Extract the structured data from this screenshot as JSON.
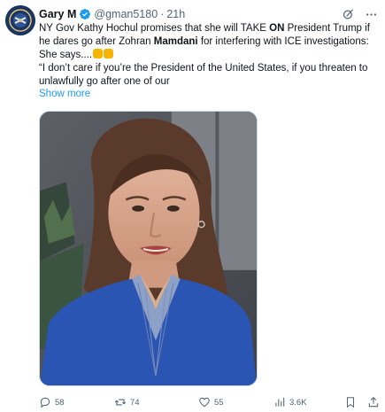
{
  "author": {
    "name": "Gary M",
    "handle": "@gman5180",
    "separator": "·",
    "time": "21h"
  },
  "tweet": {
    "segments": [
      {
        "text": "NY Gov Kathy Hochul promises that she will TAKE ",
        "bold": false
      },
      {
        "text": "ON",
        "bold": true
      },
      {
        "text": " President Trump if he dares go after Zohran ",
        "bold": false
      },
      {
        "text": "Mamdani",
        "bold": true
      },
      {
        "text": " for interfering with ICE investigations:",
        "bold": false
      }
    ],
    "line2": "She says....",
    "emojis": [
      "pointing-down-emoji",
      "pointing-down-emoji"
    ],
    "quote": "“I don’t care if you’re the President of the United States, if you threaten to unlawfully go after one of our",
    "show_more": "Show more"
  },
  "stats": {
    "replies": "58",
    "reposts": "74",
    "likes": "55",
    "views": "3.6K"
  },
  "icons": {
    "verified": "verified-badge-icon",
    "grok": "grok-icon",
    "more": "more-icon",
    "reply": "reply-icon",
    "repost": "repost-icon",
    "like": "heart-icon",
    "views": "views-icon",
    "bookmark": "bookmark-icon",
    "share": "share-icon"
  },
  "colors": {
    "accent": "#1d9bf0",
    "muted": "#536471",
    "text": "#0f1419"
  }
}
